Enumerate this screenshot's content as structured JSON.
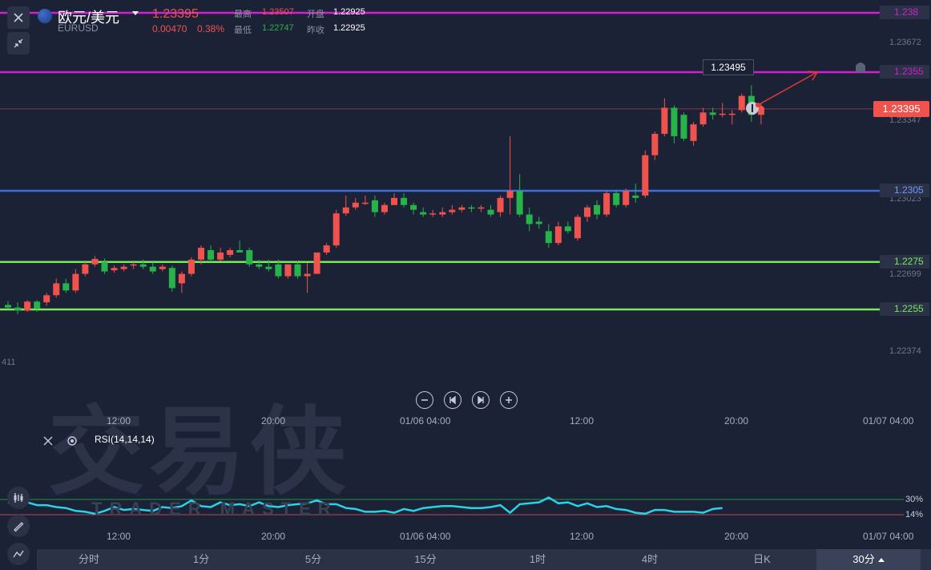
{
  "header": {
    "symbol_name": "欧元/美元",
    "symbol_code": "EURUSD",
    "price": "1.23395",
    "change": "0.00470",
    "change_pct": "0.38%",
    "high_label": "最高",
    "high_value": "1.23507",
    "low_label": "最低",
    "low_value": "1.22747",
    "open_label": "开盘",
    "open_value": "1.22925",
    "prev_close_label": "昨收",
    "prev_close_value": "1.22925"
  },
  "colors": {
    "background": "#1c2236",
    "up": "#f0524d",
    "down": "#27b24a",
    "magenta_line": "#d21fd2",
    "blue_line": "#3a6fe0",
    "green_line": "#79e85a",
    "rsi_line": "#27d3e6"
  },
  "right_axis_ticks": [
    "1.23672",
    "1.23347",
    "1.23023",
    "1.22699",
    "1.22374"
  ],
  "horizontal_lines": [
    {
      "label": "1.238",
      "color": "#d21fd2"
    },
    {
      "label": "1.2355",
      "color": "#d21fd2"
    },
    {
      "label": "1.2305",
      "color": "#3a6fe0"
    },
    {
      "label": "1.2275",
      "color": "#79e85a"
    },
    {
      "label": "1.2255",
      "color": "#79e85a"
    }
  ],
  "current_price_tag": "1.23395",
  "high_tooltip": "1.23495",
  "left_edge_price": "411",
  "time_axis": [
    "12:00",
    "20:00",
    "01/06 04:00",
    "12:00",
    "20:00",
    "01/07 04:00"
  ],
  "rsi": {
    "label": "RSI(14,14,14)",
    "levels": [
      "30%",
      "14%"
    ]
  },
  "watermark": {
    "main": "交易侠",
    "sub": "TRADER MASTER"
  },
  "timeframes": [
    {
      "label": "分时",
      "active": false
    },
    {
      "label": "1分",
      "active": false
    },
    {
      "label": "5分",
      "active": false
    },
    {
      "label": "15分",
      "active": false
    },
    {
      "label": "1时",
      "active": false
    },
    {
      "label": "4时",
      "active": false
    },
    {
      "label": "日K",
      "active": false
    },
    {
      "label": "30分",
      "active": true
    }
  ],
  "chart_data": {
    "type": "candlestick",
    "symbol": "EURUSD",
    "interval": "30分",
    "ylim": [
      1.2225,
      1.2385
    ],
    "candles": [
      {
        "o": 1.22569,
        "h": 1.22585,
        "l": 1.22552,
        "c": 1.22558
      },
      {
        "o": 1.22558,
        "h": 1.2258,
        "l": 1.2253,
        "c": 1.22545
      },
      {
        "o": 1.22545,
        "h": 1.2259,
        "l": 1.2254,
        "c": 1.22583
      },
      {
        "o": 1.22583,
        "h": 1.2259,
        "l": 1.2254,
        "c": 1.22555
      },
      {
        "o": 1.2258,
        "h": 1.2262,
        "l": 1.22565,
        "c": 1.2261
      },
      {
        "o": 1.2261,
        "h": 1.2268,
        "l": 1.226,
        "c": 1.2266
      },
      {
        "o": 1.2266,
        "h": 1.2268,
        "l": 1.2262,
        "c": 1.2263
      },
      {
        "o": 1.2263,
        "h": 1.2272,
        "l": 1.2262,
        "c": 1.227
      },
      {
        "o": 1.227,
        "h": 1.2275,
        "l": 1.2269,
        "c": 1.2274
      },
      {
        "o": 1.2274,
        "h": 1.22775,
        "l": 1.2273,
        "c": 1.22763
      },
      {
        "o": 1.2275,
        "h": 1.22765,
        "l": 1.227,
        "c": 1.2271
      },
      {
        "o": 1.22715,
        "h": 1.22735,
        "l": 1.22705,
        "c": 1.22725
      },
      {
        "o": 1.2272,
        "h": 1.2274,
        "l": 1.2271,
        "c": 1.2273
      },
      {
        "o": 1.22735,
        "h": 1.2275,
        "l": 1.2272,
        "c": 1.2274
      },
      {
        "o": 1.2274,
        "h": 1.2276,
        "l": 1.2272,
        "c": 1.2273
      },
      {
        "o": 1.2273,
        "h": 1.2275,
        "l": 1.227,
        "c": 1.2271
      },
      {
        "o": 1.2272,
        "h": 1.2274,
        "l": 1.2271,
        "c": 1.2273
      },
      {
        "o": 1.22725,
        "h": 1.22735,
        "l": 1.22625,
        "c": 1.2264
      },
      {
        "o": 1.2266,
        "h": 1.2271,
        "l": 1.2262,
        "c": 1.227
      },
      {
        "o": 1.227,
        "h": 1.2277,
        "l": 1.2269,
        "c": 1.2276
      },
      {
        "o": 1.2276,
        "h": 1.2282,
        "l": 1.2274,
        "c": 1.2281
      },
      {
        "o": 1.228,
        "h": 1.2282,
        "l": 1.2275,
        "c": 1.2276
      },
      {
        "o": 1.2276,
        "h": 1.2281,
        "l": 1.22755,
        "c": 1.2279
      },
      {
        "o": 1.2278,
        "h": 1.2281,
        "l": 1.2277,
        "c": 1.228
      },
      {
        "o": 1.228,
        "h": 1.2284,
        "l": 1.2279,
        "c": 1.2279
      },
      {
        "o": 1.228,
        "h": 1.2281,
        "l": 1.2273,
        "c": 1.2274
      },
      {
        "o": 1.2274,
        "h": 1.2276,
        "l": 1.2272,
        "c": 1.2273
      },
      {
        "o": 1.2273,
        "h": 1.2276,
        "l": 1.2271,
        "c": 1.2272
      },
      {
        "o": 1.2274,
        "h": 1.2276,
        "l": 1.2268,
        "c": 1.2269
      },
      {
        "o": 1.2269,
        "h": 1.2274,
        "l": 1.2268,
        "c": 1.2274
      },
      {
        "o": 1.2274,
        "h": 1.2275,
        "l": 1.2268,
        "c": 1.2269
      },
      {
        "o": 1.2269,
        "h": 1.22745,
        "l": 1.2262,
        "c": 1.227
      },
      {
        "o": 1.227,
        "h": 1.2279,
        "l": 1.227,
        "c": 1.2279
      },
      {
        "o": 1.2279,
        "h": 1.2283,
        "l": 1.2278,
        "c": 1.2282
      },
      {
        "o": 1.2282,
        "h": 1.2297,
        "l": 1.2281,
        "c": 1.22955
      },
      {
        "o": 1.22955,
        "h": 1.2303,
        "l": 1.22945,
        "c": 1.2298
      },
      {
        "o": 1.2298,
        "h": 1.2302,
        "l": 1.2297,
        "c": 1.23
      },
      {
        "o": 1.23,
        "h": 1.2303,
        "l": 1.2299,
        "c": 1.23
      },
      {
        "o": 1.2301,
        "h": 1.2303,
        "l": 1.2294,
        "c": 1.2296
      },
      {
        "o": 1.2296,
        "h": 1.23,
        "l": 1.2295,
        "c": 1.2299
      },
      {
        "o": 1.2299,
        "h": 1.2304,
        "l": 1.2299,
        "c": 1.2302
      },
      {
        "o": 1.2302,
        "h": 1.2304,
        "l": 1.2298,
        "c": 1.2299
      },
      {
        "o": 1.2299,
        "h": 1.23,
        "l": 1.2295,
        "c": 1.2297
      },
      {
        "o": 1.2296,
        "h": 1.2298,
        "l": 1.2294,
        "c": 1.2295
      },
      {
        "o": 1.2295,
        "h": 1.2297,
        "l": 1.2294,
        "c": 1.22955
      },
      {
        "o": 1.2295,
        "h": 1.2298,
        "l": 1.2294,
        "c": 1.2296
      },
      {
        "o": 1.2296,
        "h": 1.2299,
        "l": 1.2295,
        "c": 1.2297
      },
      {
        "o": 1.2297,
        "h": 1.2299,
        "l": 1.2296,
        "c": 1.2298
      },
      {
        "o": 1.2298,
        "h": 1.2299,
        "l": 1.2296,
        "c": 1.22975
      },
      {
        "o": 1.22975,
        "h": 1.2299,
        "l": 1.2296,
        "c": 1.2298
      },
      {
        "o": 1.2297,
        "h": 1.2299,
        "l": 1.2294,
        "c": 1.2295
      },
      {
        "o": 1.2296,
        "h": 1.2303,
        "l": 1.2294,
        "c": 1.2302
      },
      {
        "o": 1.2302,
        "h": 1.2328,
        "l": 1.2295,
        "c": 1.2305
      },
      {
        "o": 1.2305,
        "h": 1.2312,
        "l": 1.2294,
        "c": 1.2295
      },
      {
        "o": 1.2295,
        "h": 1.2298,
        "l": 1.2288,
        "c": 1.2291
      },
      {
        "o": 1.2292,
        "h": 1.2294,
        "l": 1.2289,
        "c": 1.2291
      },
      {
        "o": 1.2288,
        "h": 1.2291,
        "l": 1.2281,
        "c": 1.2283
      },
      {
        "o": 1.2283,
        "h": 1.2292,
        "l": 1.2282,
        "c": 1.229
      },
      {
        "o": 1.229,
        "h": 1.2292,
        "l": 1.2287,
        "c": 1.2288
      },
      {
        "o": 1.2285,
        "h": 1.2295,
        "l": 1.2284,
        "c": 1.2294
      },
      {
        "o": 1.2294,
        "h": 1.2299,
        "l": 1.2292,
        "c": 1.2298
      },
      {
        "o": 1.2299,
        "h": 1.2301,
        "l": 1.2293,
        "c": 1.2295
      },
      {
        "o": 1.2295,
        "h": 1.2305,
        "l": 1.2294,
        "c": 1.2304
      },
      {
        "o": 1.2304,
        "h": 1.23055,
        "l": 1.2298,
        "c": 1.2299
      },
      {
        "o": 1.2299,
        "h": 1.2306,
        "l": 1.2298,
        "c": 1.2305
      },
      {
        "o": 1.2303,
        "h": 1.2308,
        "l": 1.23,
        "c": 1.2302
      },
      {
        "o": 1.2303,
        "h": 1.2322,
        "l": 1.2302,
        "c": 1.232
      },
      {
        "o": 1.232,
        "h": 1.233,
        "l": 1.2318,
        "c": 1.2329
      },
      {
        "o": 1.2329,
        "h": 1.2344,
        "l": 1.2328,
        "c": 1.234
      },
      {
        "o": 1.234,
        "h": 1.2341,
        "l": 1.2325,
        "c": 1.2328
      },
      {
        "o": 1.2337,
        "h": 1.2338,
        "l": 1.2326,
        "c": 1.2327
      },
      {
        "o": 1.2326,
        "h": 1.2334,
        "l": 1.2324,
        "c": 1.2333
      },
      {
        "o": 1.2333,
        "h": 1.234,
        "l": 1.2332,
        "c": 1.2338
      },
      {
        "o": 1.2338,
        "h": 1.234,
        "l": 1.2335,
        "c": 1.2337
      },
      {
        "o": 1.2337,
        "h": 1.2342,
        "l": 1.2336,
        "c": 1.23375
      },
      {
        "o": 1.2337,
        "h": 1.2339,
        "l": 1.2333,
        "c": 1.23375
      },
      {
        "o": 1.2339,
        "h": 1.2346,
        "l": 1.2338,
        "c": 1.2345
      },
      {
        "o": 1.2345,
        "h": 1.23495,
        "l": 1.2334,
        "c": 1.2337
      },
      {
        "o": 1.2337,
        "h": 1.2342,
        "l": 1.2333,
        "c": 1.23395
      }
    ],
    "rsi_values": [
      33,
      34,
      33,
      36,
      36,
      38,
      39,
      42,
      43,
      45,
      42,
      38,
      41,
      40,
      41,
      42,
      38,
      39,
      37,
      31,
      37,
      38,
      33,
      36,
      35,
      37,
      33,
      37,
      38,
      36,
      35,
      34,
      31,
      35,
      35,
      39,
      40,
      43,
      43,
      42,
      44,
      40,
      42,
      39,
      38,
      37,
      37,
      38,
      39,
      39,
      38,
      36,
      44,
      35,
      34,
      33,
      28,
      34,
      33,
      37,
      34,
      38,
      37,
      40,
      41,
      44,
      45,
      41,
      41,
      43,
      43,
      43,
      44,
      40,
      39
    ]
  }
}
